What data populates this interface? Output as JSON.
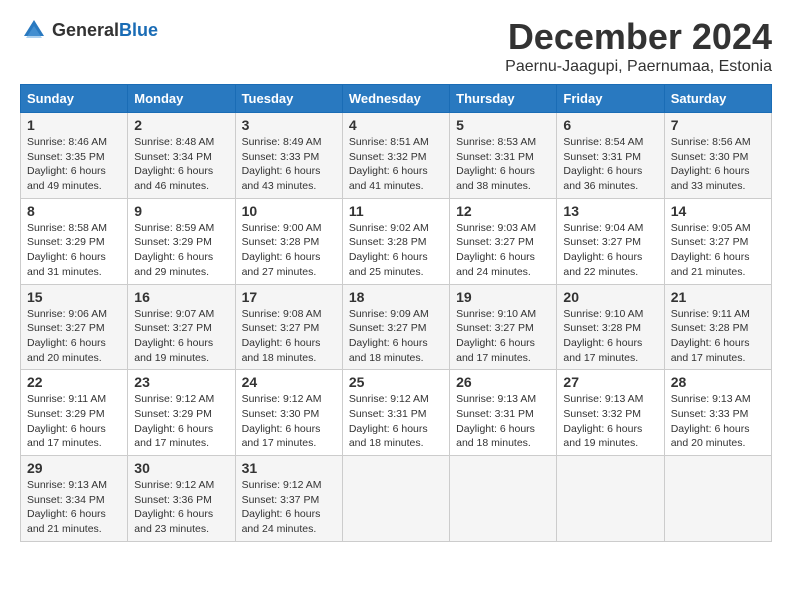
{
  "logo": {
    "general": "General",
    "blue": "Blue"
  },
  "title": "December 2024",
  "subtitle": "Paernu-Jaagupi, Paernumaa, Estonia",
  "days_of_week": [
    "Sunday",
    "Monday",
    "Tuesday",
    "Wednesday",
    "Thursday",
    "Friday",
    "Saturday"
  ],
  "weeks": [
    [
      {
        "day": "1",
        "sunrise": "8:46 AM",
        "sunset": "3:35 PM",
        "daylight_hours": "6",
        "daylight_minutes": "49"
      },
      {
        "day": "2",
        "sunrise": "8:48 AM",
        "sunset": "3:34 PM",
        "daylight_hours": "6",
        "daylight_minutes": "46"
      },
      {
        "day": "3",
        "sunrise": "8:49 AM",
        "sunset": "3:33 PM",
        "daylight_hours": "6",
        "daylight_minutes": "43"
      },
      {
        "day": "4",
        "sunrise": "8:51 AM",
        "sunset": "3:32 PM",
        "daylight_hours": "6",
        "daylight_minutes": "41"
      },
      {
        "day": "5",
        "sunrise": "8:53 AM",
        "sunset": "3:31 PM",
        "daylight_hours": "6",
        "daylight_minutes": "38"
      },
      {
        "day": "6",
        "sunrise": "8:54 AM",
        "sunset": "3:31 PM",
        "daylight_hours": "6",
        "daylight_minutes": "36"
      },
      {
        "day": "7",
        "sunrise": "8:56 AM",
        "sunset": "3:30 PM",
        "daylight_hours": "6",
        "daylight_minutes": "33"
      }
    ],
    [
      {
        "day": "8",
        "sunrise": "8:58 AM",
        "sunset": "3:29 PM",
        "daylight_hours": "6",
        "daylight_minutes": "31"
      },
      {
        "day": "9",
        "sunrise": "8:59 AM",
        "sunset": "3:29 PM",
        "daylight_hours": "6",
        "daylight_minutes": "29"
      },
      {
        "day": "10",
        "sunrise": "9:00 AM",
        "sunset": "3:28 PM",
        "daylight_hours": "6",
        "daylight_minutes": "27"
      },
      {
        "day": "11",
        "sunrise": "9:02 AM",
        "sunset": "3:28 PM",
        "daylight_hours": "6",
        "daylight_minutes": "25"
      },
      {
        "day": "12",
        "sunrise": "9:03 AM",
        "sunset": "3:27 PM",
        "daylight_hours": "6",
        "daylight_minutes": "24"
      },
      {
        "day": "13",
        "sunrise": "9:04 AM",
        "sunset": "3:27 PM",
        "daylight_hours": "6",
        "daylight_minutes": "22"
      },
      {
        "day": "14",
        "sunrise": "9:05 AM",
        "sunset": "3:27 PM",
        "daylight_hours": "6",
        "daylight_minutes": "21"
      }
    ],
    [
      {
        "day": "15",
        "sunrise": "9:06 AM",
        "sunset": "3:27 PM",
        "daylight_hours": "6",
        "daylight_minutes": "20"
      },
      {
        "day": "16",
        "sunrise": "9:07 AM",
        "sunset": "3:27 PM",
        "daylight_hours": "6",
        "daylight_minutes": "19"
      },
      {
        "day": "17",
        "sunrise": "9:08 AM",
        "sunset": "3:27 PM",
        "daylight_hours": "6",
        "daylight_minutes": "18"
      },
      {
        "day": "18",
        "sunrise": "9:09 AM",
        "sunset": "3:27 PM",
        "daylight_hours": "6",
        "daylight_minutes": "18"
      },
      {
        "day": "19",
        "sunrise": "9:10 AM",
        "sunset": "3:27 PM",
        "daylight_hours": "6",
        "daylight_minutes": "17"
      },
      {
        "day": "20",
        "sunrise": "9:10 AM",
        "sunset": "3:28 PM",
        "daylight_hours": "6",
        "daylight_minutes": "17"
      },
      {
        "day": "21",
        "sunrise": "9:11 AM",
        "sunset": "3:28 PM",
        "daylight_hours": "6",
        "daylight_minutes": "17"
      }
    ],
    [
      {
        "day": "22",
        "sunrise": "9:11 AM",
        "sunset": "3:29 PM",
        "daylight_hours": "6",
        "daylight_minutes": "17"
      },
      {
        "day": "23",
        "sunrise": "9:12 AM",
        "sunset": "3:29 PM",
        "daylight_hours": "6",
        "daylight_minutes": "17"
      },
      {
        "day": "24",
        "sunrise": "9:12 AM",
        "sunset": "3:30 PM",
        "daylight_hours": "6",
        "daylight_minutes": "17"
      },
      {
        "day": "25",
        "sunrise": "9:12 AM",
        "sunset": "3:31 PM",
        "daylight_hours": "6",
        "daylight_minutes": "18"
      },
      {
        "day": "26",
        "sunrise": "9:13 AM",
        "sunset": "3:31 PM",
        "daylight_hours": "6",
        "daylight_minutes": "18"
      },
      {
        "day": "27",
        "sunrise": "9:13 AM",
        "sunset": "3:32 PM",
        "daylight_hours": "6",
        "daylight_minutes": "19"
      },
      {
        "day": "28",
        "sunrise": "9:13 AM",
        "sunset": "3:33 PM",
        "daylight_hours": "6",
        "daylight_minutes": "20"
      }
    ],
    [
      {
        "day": "29",
        "sunrise": "9:13 AM",
        "sunset": "3:34 PM",
        "daylight_hours": "6",
        "daylight_minutes": "21"
      },
      {
        "day": "30",
        "sunrise": "9:12 AM",
        "sunset": "3:36 PM",
        "daylight_hours": "6",
        "daylight_minutes": "23"
      },
      {
        "day": "31",
        "sunrise": "9:12 AM",
        "sunset": "3:37 PM",
        "daylight_hours": "6",
        "daylight_minutes": "24"
      },
      null,
      null,
      null,
      null
    ]
  ],
  "labels": {
    "sunrise": "Sunrise:",
    "sunset": "Sunset:",
    "daylight": "Daylight:",
    "daylight_text": "Daylight: {h} hours and {m} minutes."
  }
}
